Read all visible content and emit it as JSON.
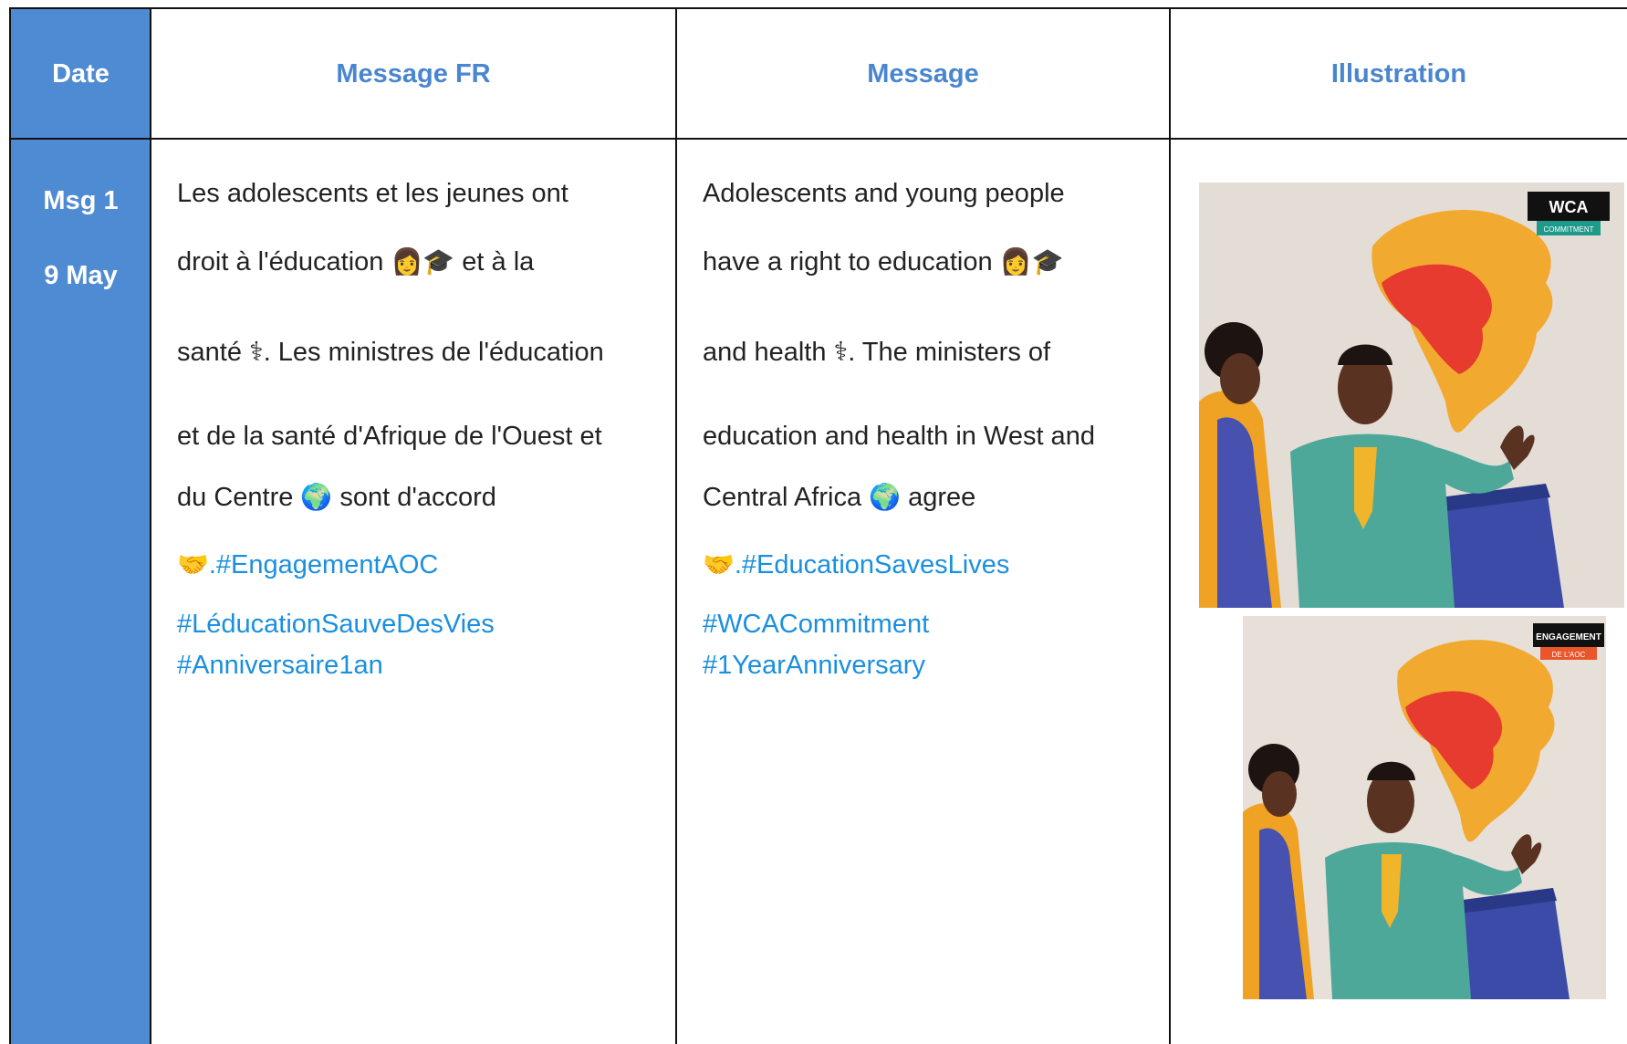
{
  "headers": {
    "date": "Date",
    "message_fr": "Message FR",
    "message": "Message",
    "illustration": "Illustration"
  },
  "row": {
    "msg": "Msg 1",
    "date": "9 May",
    "fr": {
      "line1": "Les adolescents et les jeunes ont",
      "line2a": "droit à l'éducation",
      "line2_emoji": "👩🎓",
      "line2b": "et à la",
      "line3": "santé ⚕. Les ministres de l'éducation",
      "line4": "et de la santé d'Afrique de l'Ouest et",
      "line5a": "du Centre",
      "line5_emoji": "🌍",
      "line5b": "sont d'accord",
      "line6_emoji": "🤝",
      "hashtag1": ".#EngagementAOC",
      "hashtag2": "#LéducationSauveDesVies",
      "hashtag3": "#Anniversaire1an"
    },
    "en": {
      "line1": "Adolescents and young people",
      "line2a": "have a right to education",
      "line2_emoji": "👩🎓",
      "line3": "and health ⚕. The ministers of",
      "line4": "education and health in West and",
      "line5a": "Central Africa",
      "line5_emoji": "🌍",
      "line5b": "agree",
      "line6_emoji": "🤝",
      "hashtag1": ".#EducationSavesLives",
      "hashtag2": "#WCACommitment",
      "hashtag3": "#1YearAnniversary"
    },
    "illustration": {
      "badge_top": "WCA",
      "badge_top_sub": "COMMITMENT",
      "badge_bottom": "ENGAGEMENT",
      "badge_bottom_sub": "DE L'AOC"
    }
  },
  "colors": {
    "header_blue": "#4a86d0",
    "date_column": "#4f8bd3",
    "hashtag": "#1a8fe0"
  }
}
